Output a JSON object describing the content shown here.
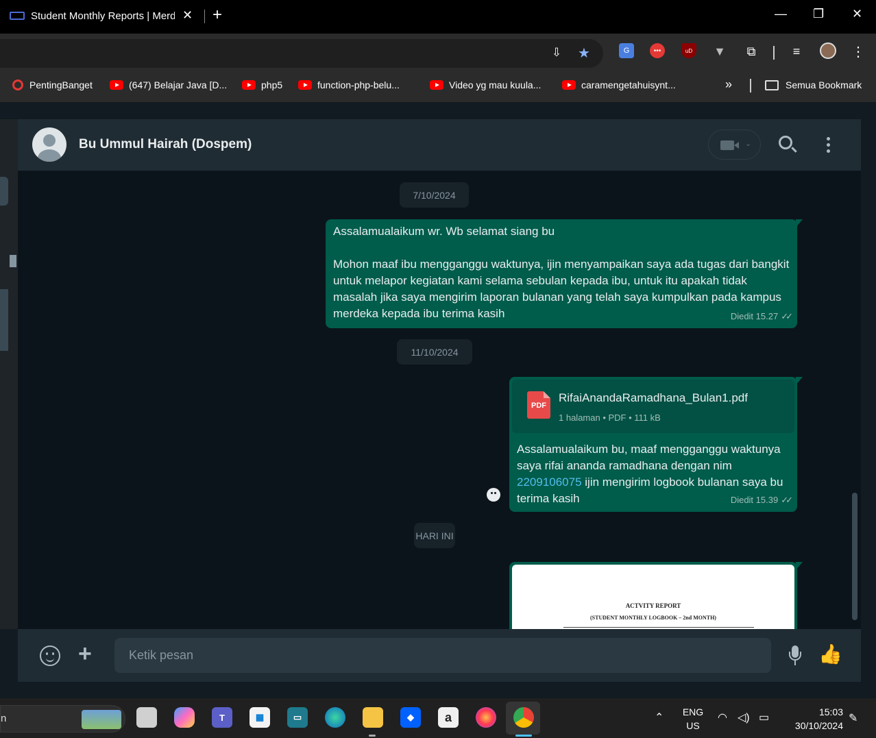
{
  "browser": {
    "tab_title": "Student Monthly Reports | Merdeka",
    "tab_close": "✕",
    "new_tab": "+",
    "window_minimize": "—",
    "window_restore": "❐",
    "window_close": "✕"
  },
  "bookmarks": [
    {
      "label": "PentingBanget",
      "icon": "quora-icon"
    },
    {
      "label": "(647) Belajar Java [D...",
      "icon": "youtube-icon"
    },
    {
      "label": "php5",
      "icon": "youtube-icon"
    },
    {
      "label": "function-php-belu...",
      "icon": "youtube-icon"
    },
    {
      "label": "Video yg mau kuula...",
      "icon": "youtube-icon"
    },
    {
      "label": "caramengetahuisynt...",
      "icon": "youtube-icon"
    }
  ],
  "bookmarks_more": "»",
  "bookmarks_folder": "Semua Bookmark",
  "chat": {
    "contact_name": "Bu Ummul Hairah (Dospem)",
    "dates": [
      "7/10/2024",
      "11/10/2024",
      "HARI INI"
    ],
    "messages": [
      {
        "text": "Assalamualaikum wr. Wb selamat siang bu\n\nMohon maaf ibu mengganggu waktunya, ijin menyampaikan saya ada tugas dari bangkit untuk melapor kegiatan kami selama sebulan kepada ibu, untuk itu apakah tidak masalah jika saya mengirim laporan bulanan yang telah saya kumpulkan pada kampus merdeka kepada ibu terima kasih",
        "meta": "Diedit 15.27"
      },
      {
        "document_name": "RifaiAnandaRamadhana_Bulan1.pdf",
        "document_meta": "1 halaman • PDF • 111 kB",
        "pdf_label": "PDF",
        "text_before_link": "Assalamualaikum bu, maaf mengganggu waktunya saya rifai ananda ramadhana dengan nim ",
        "link": "2209106075",
        "text_after_link": " ijin mengirim logbook bulanan saya bu terima kasih",
        "meta": "Diedit 15.39"
      },
      {
        "preview_title": "ACTVITY REPORT",
        "preview_subtitle": "(STUDENT MONTHLY LOGBOOK – 2nd MONTH)"
      }
    ],
    "ticks": "✓✓",
    "compose_placeholder": "Ketik pesan"
  },
  "taskbar": {
    "search_text": "n",
    "apps": [
      "task-view",
      "copilot",
      "teams",
      "store",
      "terminal",
      "edge",
      "file-explorer",
      "dropbox",
      "amazon",
      "firefox",
      "chrome"
    ],
    "language": "ENG",
    "region": "US",
    "time": "15:03",
    "date": "30/10/2024"
  },
  "colors": {
    "chat_bg": "#0b141a",
    "header_bg": "#202c33",
    "outgoing_bubble": "#005c4b",
    "link": "#53bdeb"
  }
}
